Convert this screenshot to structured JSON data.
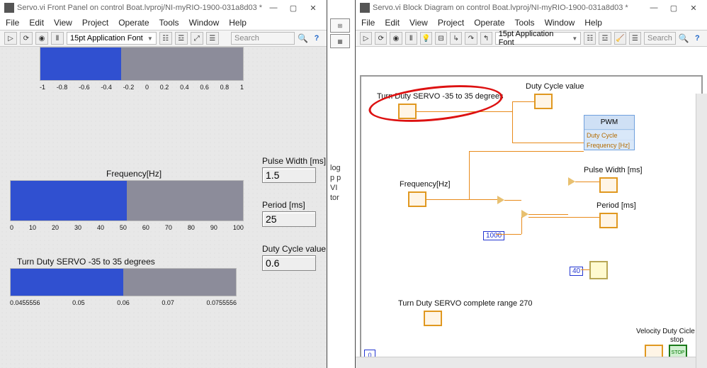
{
  "left": {
    "title": "Servo.vi Front Panel on control Boat.lvproj/NI-myRIO-1900-031a8d03 *",
    "menu": [
      "File",
      "Edit",
      "View",
      "Project",
      "Operate",
      "Tools",
      "Window",
      "Help"
    ],
    "font": "15pt Application Font",
    "search_ph": "Search",
    "slider1": {
      "label": "",
      "ticks": [
        "-1",
        "-0.8",
        "-0.6",
        "-0.4",
        "-0.2",
        "0",
        "0.2",
        "0.4",
        "0.6",
        "0.8",
        "1"
      ],
      "fill_pct": 40
    },
    "slider2": {
      "label": "Frequency[Hz]",
      "ticks": [
        "0",
        "10",
        "20",
        "30",
        "40",
        "50",
        "60",
        "70",
        "80",
        "90",
        "100"
      ],
      "fill_pct": 50
    },
    "slider3": {
      "label": "Turn Duty SERVO -35 to 35 degrees",
      "ticks": [
        "0.0455556",
        "0.05",
        "0.06",
        "0.07",
        "0.0755556"
      ],
      "fill_pct": 50
    },
    "ind1": {
      "label": "Pulse Width [ms]",
      "value": "1.5"
    },
    "ind2": {
      "label": "Period [ms]",
      "value": "25"
    },
    "ind3": {
      "label": "Duty Cycle value",
      "value": "0.6"
    }
  },
  "mid": {
    "clip": [
      "log",
      "p p",
      "VI",
      "tor"
    ]
  },
  "right": {
    "title": "Servo.vi Block Diagram on control Boat.lvproj/NI-myRIO-1900-031a8d03 *",
    "menu": [
      "File",
      "Edit",
      "View",
      "Project",
      "Operate",
      "Tools",
      "Window",
      "Help"
    ],
    "font": "15pt Application Font",
    "search_ph": "Search",
    "labels": {
      "turn": "Turn Duty SERVO -35 to 35 degrees",
      "dcv": "Duty Cycle value",
      "freq": "Frequency[Hz]",
      "pw": "Pulse Width [ms]",
      "per": "Period [ms]",
      "turn270": "Turn Duty SERVO complete range 270",
      "vel": "Velocity Duty Cicle",
      "stop": "stop"
    },
    "pwm": {
      "title": "PWM",
      "rows": [
        "Duty Cycle",
        "Frequency [Hz]"
      ]
    },
    "const1000": "1000",
    "const40": "40",
    "layer": "0"
  }
}
